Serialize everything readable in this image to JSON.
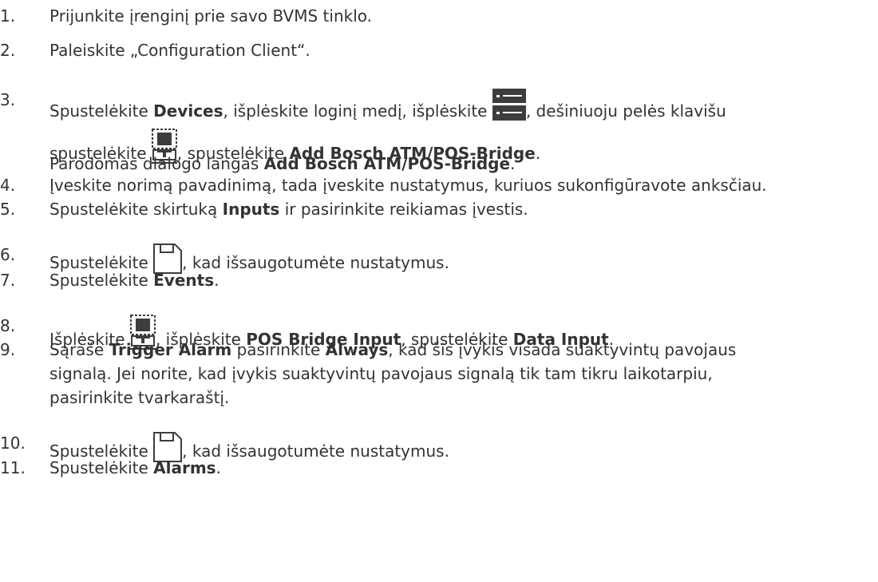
{
  "steps": [
    {
      "num": "1.",
      "text": "Prijunkite įrenginį prie savo BVMS tinklo."
    },
    {
      "num": "2.",
      "text": "Paleiskite „Configuration Client“."
    },
    {
      "num": "3.",
      "t1": "Spustelėkite ",
      "b1": "Devices",
      "t2": ", išplėskite loginį medį, išplėskite ",
      "t3": ", dešiniuoju pelės klavišu",
      "t4": "spustelėkite ",
      "t5": ", spustelėkite ",
      "b2": "Add Bosch ATM/POS-Bridge",
      "t6": ".",
      "t7": "Parodomas dialogo langas ",
      "b3": "Add Bosch ATM/POS-Bridge",
      "t8": "."
    },
    {
      "num": "4.",
      "text": "Įveskite norimą pavadinimą, tada įveskite nustatymus, kuriuos sukonfigūravote anksčiau."
    },
    {
      "num": "5.",
      "t1": "Spustelėkite skirtuką ",
      "b1": "Inputs",
      "t2": " ir pasirinkite reikiamas įvestis."
    },
    {
      "num": "6.",
      "t1": "Spustelėkite ",
      "t2": ", kad išsaugotumėte nustatymus."
    },
    {
      "num": "7.",
      "t1": "Spustelėkite ",
      "b1": "Events",
      "t2": "."
    },
    {
      "num": "8.",
      "t1": "Išplėskite ",
      "t2": ", išplėskite ",
      "b1": "POS Bridge Input",
      "t3": ", spustelėkite ",
      "b2": "Data Input",
      "t4": "."
    },
    {
      "num": "9.",
      "t1": "Sąraše ",
      "b1": "Trigger Alarm",
      "t2": " pasirinkite ",
      "b2": "Always",
      "t3": ", kad šis įvykis visada suaktyvintų pavojaus",
      "line2": "signalą. Jei norite, kad įvykis suaktyvintų pavojaus signalą tik tam tikru laikotarpiu,",
      "line3": "pasirinkite tvarkaraštį."
    },
    {
      "num": "10.",
      "t1": "Spustelėkite ",
      "t2": ", kad išsaugotumėte nustatymus."
    },
    {
      "num": "11.",
      "t1": "Spustelėkite ",
      "b1": "Alarms",
      "t2": "."
    }
  ],
  "colors": {
    "text": "#333333",
    "icon_dark": "#3d3d3d"
  },
  "icons": {
    "devices_tree": "device-tree-icon",
    "atm_pos": "atm-pos-bridge-icon",
    "save": "save-icon"
  }
}
